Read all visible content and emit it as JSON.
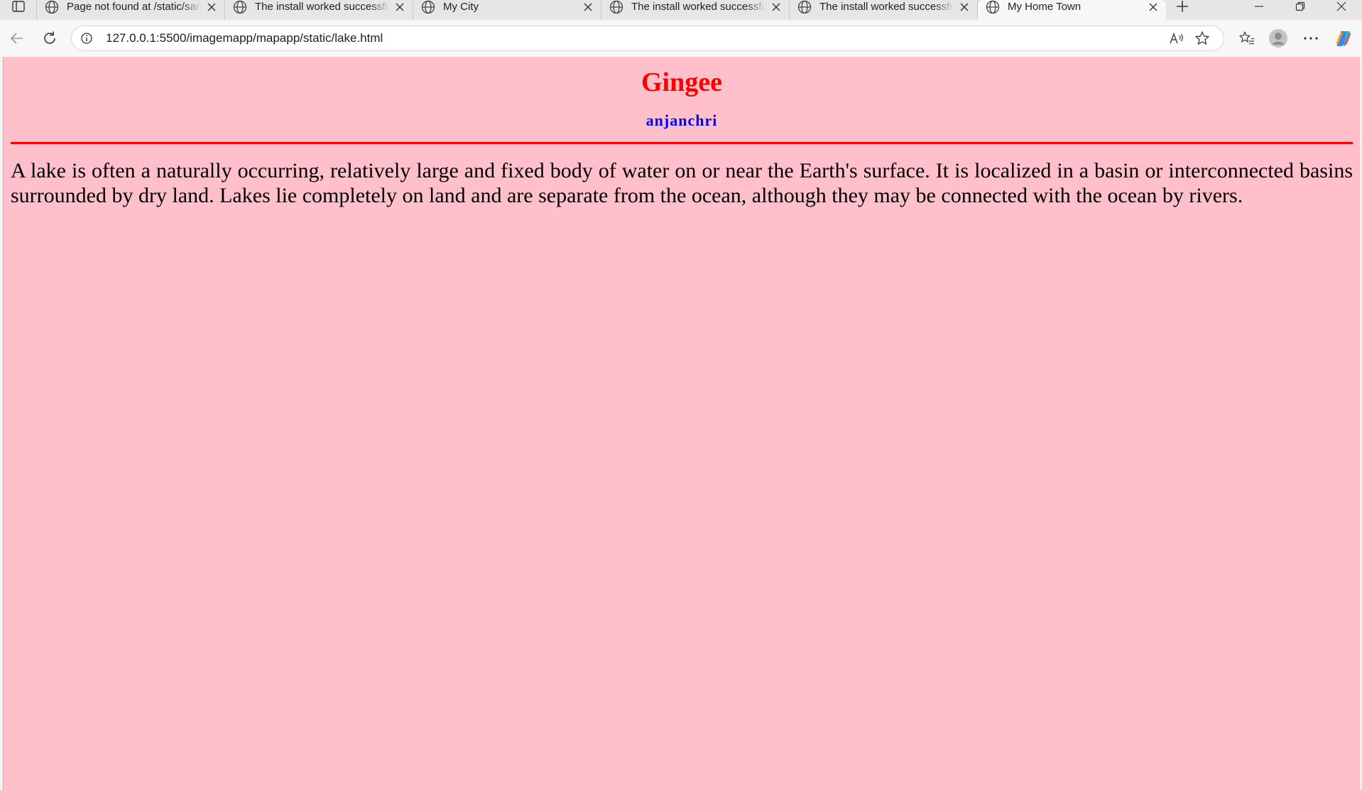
{
  "browser": {
    "tabs": [
      {
        "title": "Page not found at /static/sample"
      },
      {
        "title": "The install worked successfully!"
      },
      {
        "title": "My City"
      },
      {
        "title": "The install worked successfully!"
      },
      {
        "title": "The install worked successfully!"
      },
      {
        "title": "My Home Town"
      }
    ],
    "active_tab_index": 5,
    "url": "127.0.0.1:5500/imagemapp/mapapp/static/lake.html"
  },
  "page": {
    "heading": "Gingee",
    "author": "anjanchri",
    "paragraph": "A lake is often a naturally occurring, relatively large and fixed body of water on or near the Earth's surface. It is localized in a basin or interconnected basins surrounded by dry land. Lakes lie completely on land and are separate from the ocean, although they may be connected with the ocean by rivers."
  },
  "colors": {
    "page_background": "#ffc0cb",
    "heading": "#ff0000",
    "author": "#0000ff",
    "rule": "#ff0000"
  }
}
